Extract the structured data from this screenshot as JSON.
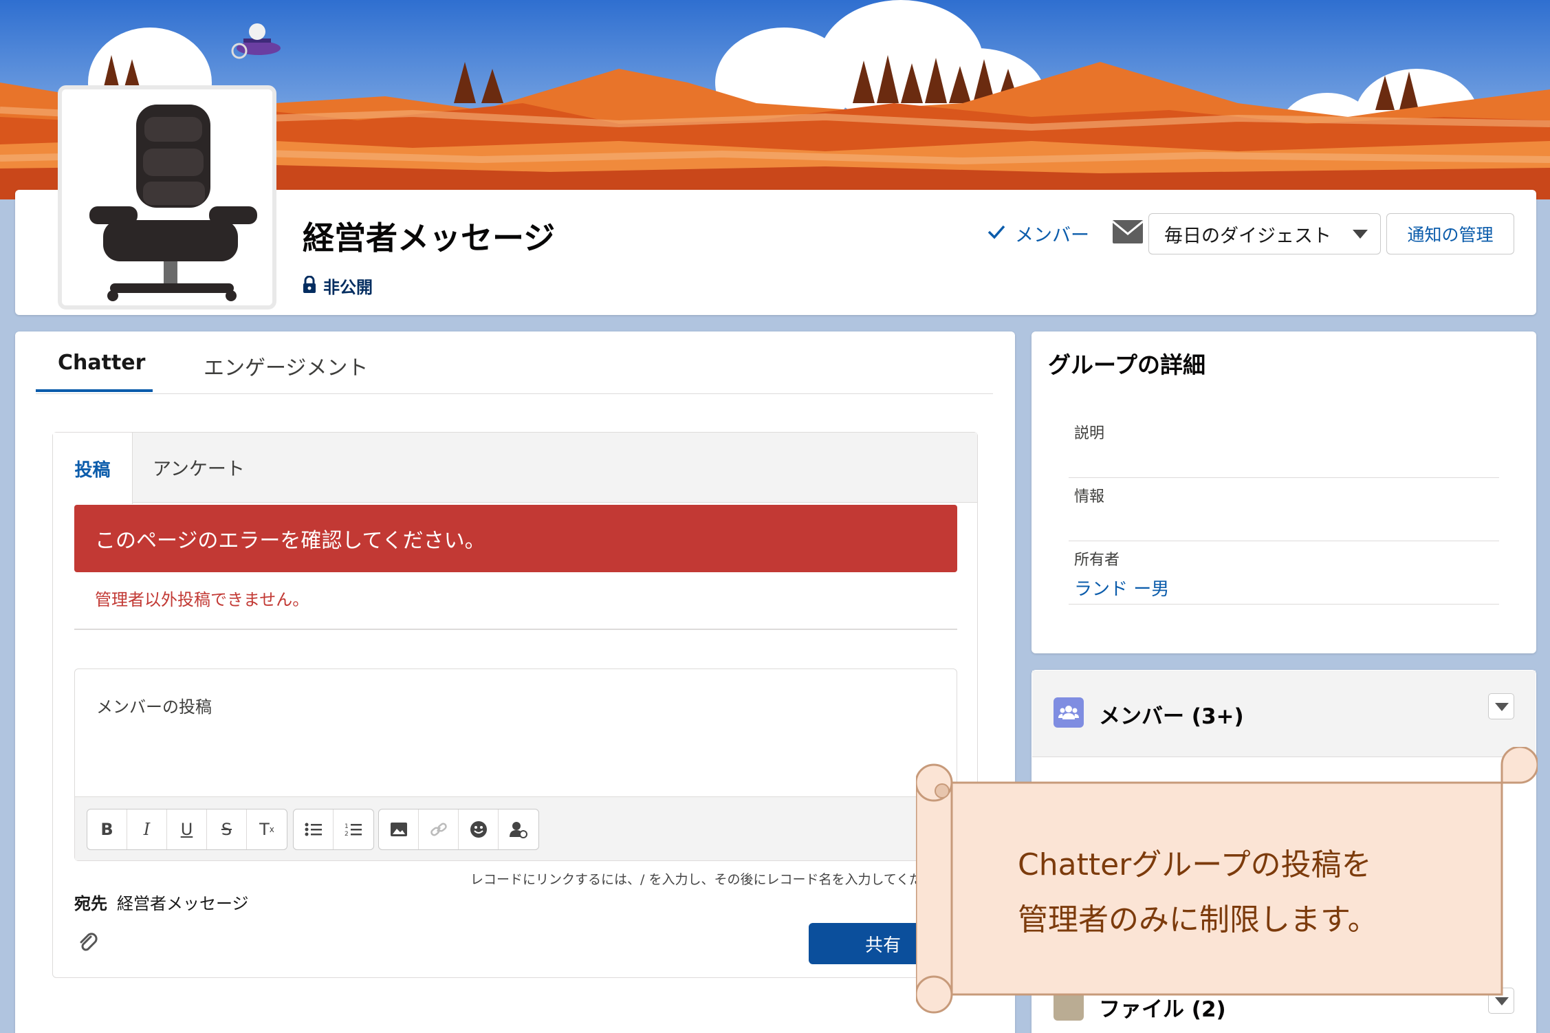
{
  "header": {
    "group_name": "経営者メッセージ",
    "privacy": "非公開",
    "member_status": "メンバー",
    "digest_option": "毎日のダイジェスト",
    "notify_button": "通知の管理"
  },
  "main": {
    "tabs": [
      {
        "label": "Chatter"
      },
      {
        "label": "エンゲージメント"
      }
    ],
    "publisher": {
      "tabs": [
        {
          "label": "投稿"
        },
        {
          "label": "アンケート"
        }
      ],
      "error_banner": "このページのエラーを確認してください。",
      "error_detail": "管理者以外投稿できません。",
      "editor_placeholder": "メンバーの投稿",
      "toolbar": [
        "B",
        "I",
        "U",
        "S",
        "Tx",
        "bullet-list",
        "number-list",
        "image",
        "link",
        "emoji",
        "mention"
      ],
      "link_hint": "レコードにリンクするには、/ を入力し、その後にレコード名を入力してくだ",
      "recipient_label": "宛先",
      "recipient_value": "経営者メッセージ",
      "share_button": "共有"
    }
  },
  "details": {
    "title": "グループの詳細",
    "fields": [
      {
        "label": "説明"
      },
      {
        "label": "情報"
      },
      {
        "label": "所有者",
        "value": "ランド ー男"
      }
    ]
  },
  "members": {
    "title": "メンバー (3+)"
  },
  "files": {
    "title": "ファイル (2)"
  },
  "callout": {
    "line1": "Chatterグループの投稿を",
    "line2": "管理者のみに制限します。"
  }
}
